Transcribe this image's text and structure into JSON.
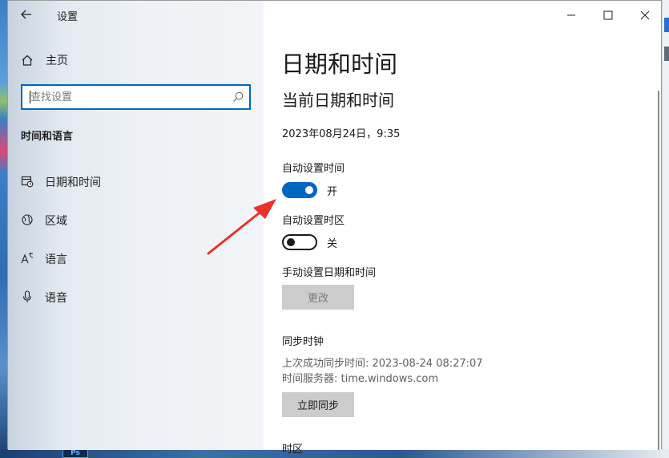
{
  "window": {
    "title": "设置"
  },
  "sidebar": {
    "home_label": "主页",
    "search_placeholder": "查找设置",
    "section_heading": "时间和语言",
    "items": [
      {
        "label": "日期和时间",
        "icon": "calendar-clock-icon",
        "active": true
      },
      {
        "label": "区域",
        "icon": "globe-region-icon",
        "active": false
      },
      {
        "label": "语言",
        "icon": "language-icon",
        "active": false
      },
      {
        "label": "语音",
        "icon": "microphone-icon",
        "active": false
      }
    ]
  },
  "main": {
    "page_title": "日期和时间",
    "sub_title": "当前日期和时间",
    "current_datetime": "2023年08月24日，9:35",
    "auto_time": {
      "label": "自动设置时间",
      "state_label": "开",
      "on": true
    },
    "auto_timezone": {
      "label": "自动设置时区",
      "state_label": "关",
      "on": false
    },
    "manual": {
      "label": "手动设置日期和时间",
      "button_label": "更改",
      "enabled": false
    },
    "sync": {
      "heading": "同步时钟",
      "last_sync": "上次成功同步时间: 2023-08-24 08:27:07",
      "time_server": "时间服务器: time.windows.com",
      "button_label": "立即同步"
    },
    "timezone_heading": "时区"
  },
  "taskbar": {
    "app_glyph": "Ps"
  },
  "colors": {
    "accent": "#0067c0",
    "annotation_arrow": "#e8322b",
    "disabled_button_bg": "#cccccc"
  }
}
